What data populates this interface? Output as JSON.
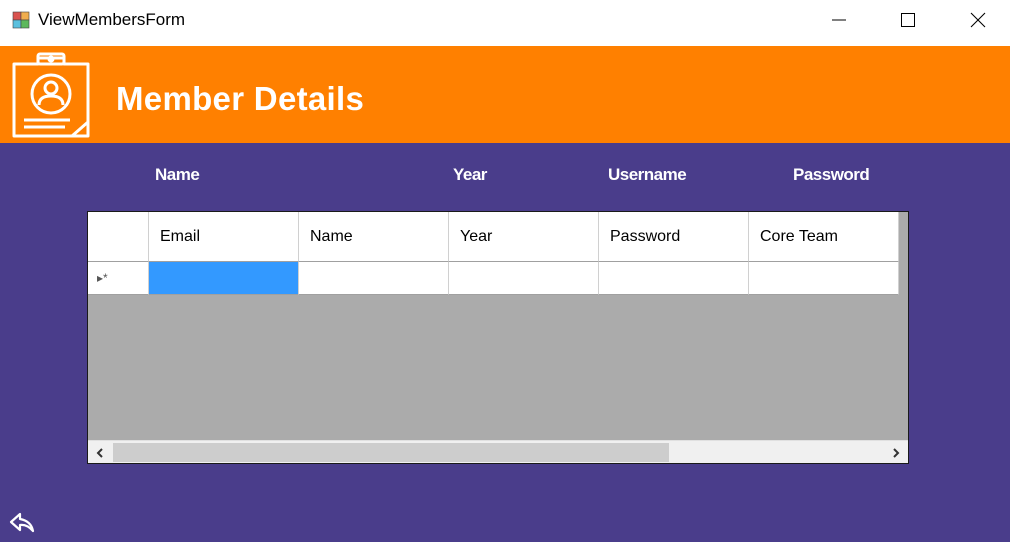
{
  "window": {
    "title": "ViewMembersForm",
    "icons": [
      "app-icon",
      "minimize-icon",
      "maximize-icon",
      "close-icon"
    ]
  },
  "banner": {
    "title": "Member Details",
    "logo_icon": "clipboard-member-icon",
    "color": "#ff8000"
  },
  "main": {
    "background": "#4a3d8b",
    "header_labels": {
      "name": "Name",
      "year": "Year",
      "username": "Username",
      "password": "Password"
    }
  },
  "grid": {
    "columns": [
      "Email",
      "Name",
      "Year",
      "Password",
      "Core Team"
    ],
    "new_row_marker": "▸*",
    "rows": [
      [
        "",
        "",
        "",
        "",
        ""
      ]
    ],
    "selected_cell": "row 1, Email",
    "selection_color": "#3399ff",
    "scroll_left_icon": "chevron-left-icon",
    "scroll_right_icon": "chevron-right-icon"
  },
  "footer": {
    "back_icon": "back-arrow-icon"
  }
}
